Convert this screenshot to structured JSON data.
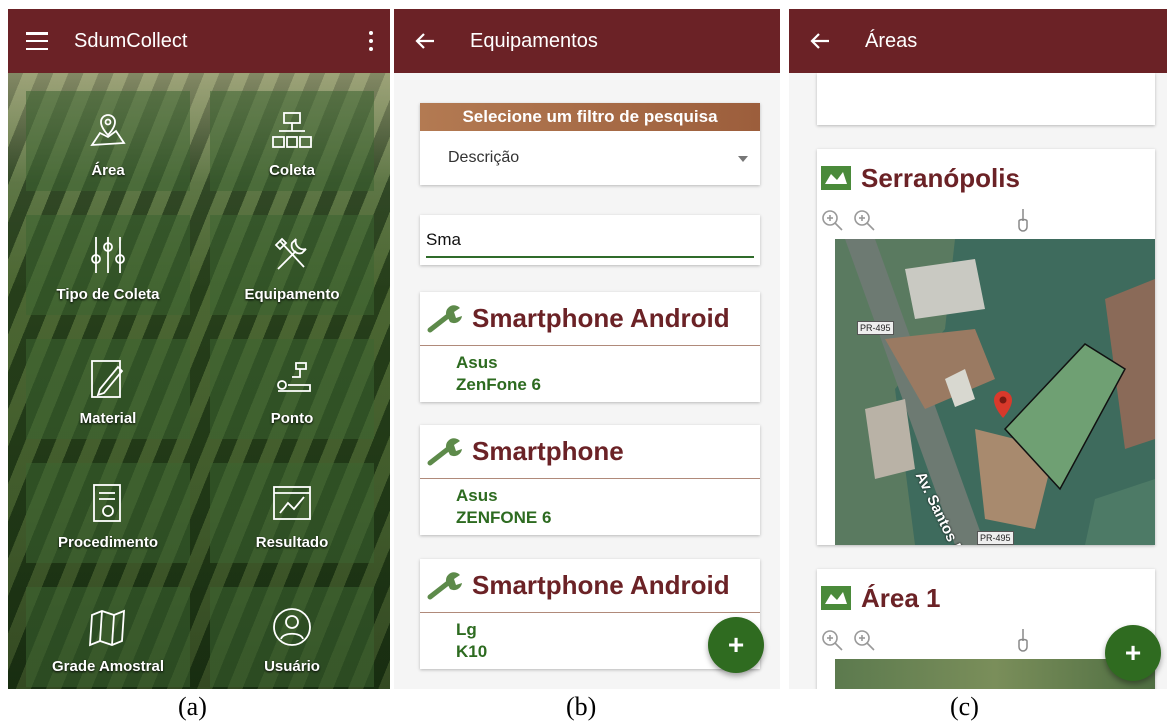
{
  "panel_a": {
    "app_title": "SdumCollect",
    "tiles": [
      {
        "label": "Área",
        "icon": "map-pin-icon"
      },
      {
        "label": "Coleta",
        "icon": "hierarchy-icon"
      },
      {
        "label": "Tipo de Coleta",
        "icon": "sliders-icon"
      },
      {
        "label": "Equipamento",
        "icon": "tools-icon"
      },
      {
        "label": "Material",
        "icon": "document-edit-icon"
      },
      {
        "label": "Ponto",
        "icon": "point-marker-icon"
      },
      {
        "label": "Procedimento",
        "icon": "procedure-icon"
      },
      {
        "label": "Resultado",
        "icon": "chart-window-icon"
      },
      {
        "label": "Grade Amostral",
        "icon": "folded-map-icon"
      },
      {
        "label": "Usuário",
        "icon": "user-circle-icon"
      }
    ]
  },
  "panel_b": {
    "title": "Equipamentos",
    "filter_header": "Selecione um filtro de pesquisa",
    "filter_value": "Descrição",
    "search_value": "Sma",
    "items": [
      {
        "name": "Smartphone Android",
        "brand": "Asus",
        "model": "ZenFone 6"
      },
      {
        "name": "Smartphone",
        "brand": "Asus",
        "model": "ZENFONE 6"
      },
      {
        "name": "Smartphone Android",
        "brand": "Lg",
        "model": "K10"
      }
    ],
    "fab": "+"
  },
  "panel_c": {
    "title": "Áreas",
    "areas": [
      {
        "name": "Serranópolis",
        "map_labels": [
          "PR-495",
          "Av. Santos Du",
          "PR-495"
        ]
      },
      {
        "name": "Área 1"
      }
    ],
    "fab": "+"
  },
  "captions": [
    "(a)",
    "(b)",
    "(c)"
  ],
  "colors": {
    "appbar": "#6b2226",
    "accent_green": "#2f6b20",
    "title_red": "#6b2226"
  }
}
